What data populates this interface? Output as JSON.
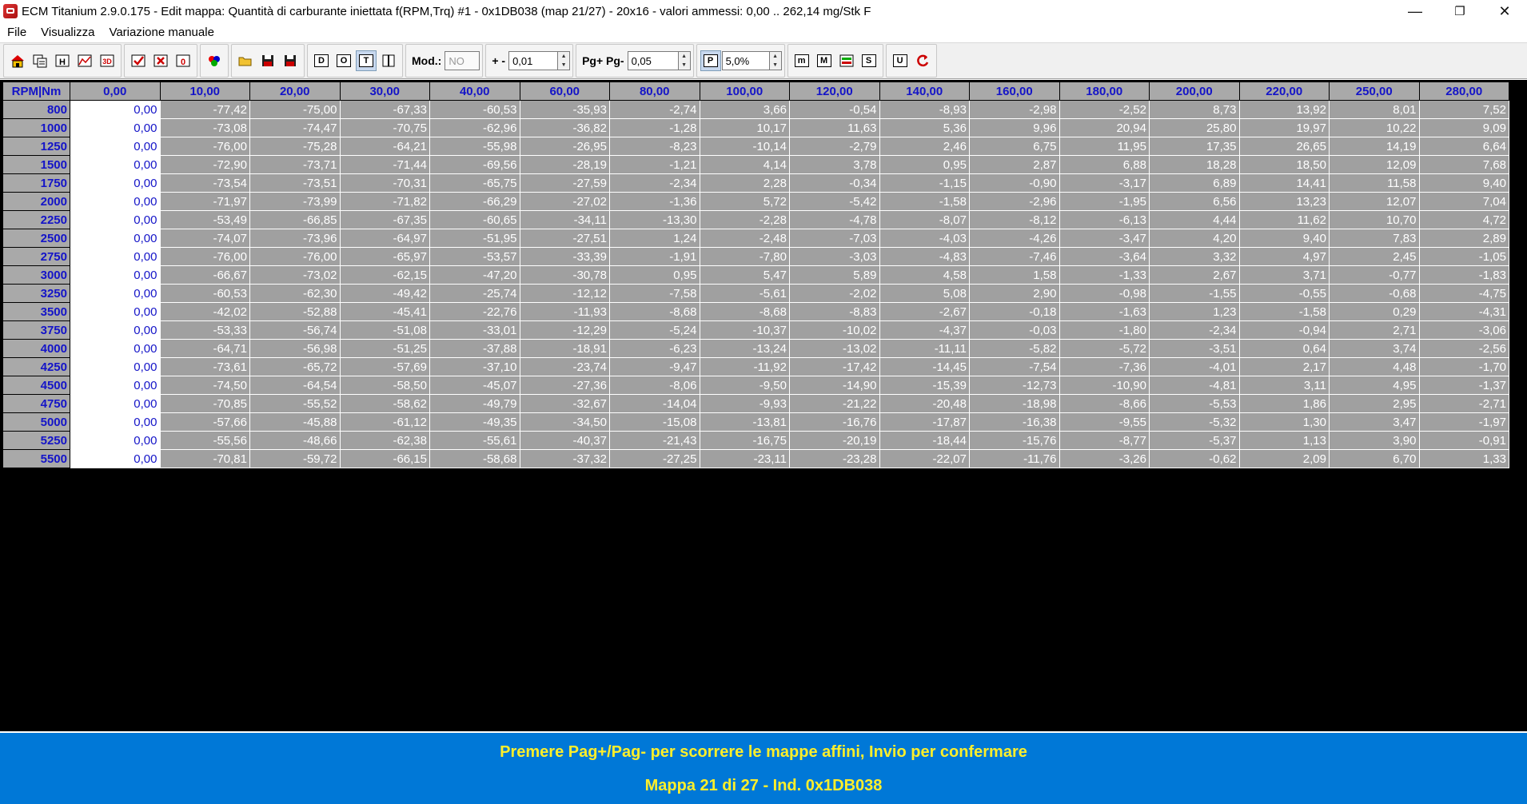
{
  "window": {
    "title": "ECM Titanium 2.9.0.175 - Edit mappa: Quantità di carburante iniettata f(RPM,Trq) #1 - 0x1DB038 (map 21/27) - 20x16 - valori ammessi: 0,00 .. 262,14 mg/Stk F",
    "minimize": "—",
    "restore": "❐",
    "close": "✕"
  },
  "menu": [
    "File",
    "Visualizza",
    "Variazione manuale"
  ],
  "toolbar": {
    "mod_label": "Mod.:",
    "mod_value": "NO",
    "plusminus_label": "+ -",
    "step_value": "0,01",
    "pg_label": "Pg+ Pg-",
    "pg_value": "0,05",
    "pct_value": "5,0%",
    "btn_d": "D",
    "btn_o": "O",
    "btn_t": "T",
    "btn_p": "P",
    "btn_m": "m",
    "btn_M": "M",
    "btn_s": "S",
    "btn_u": "U"
  },
  "table": {
    "corner": "RPM|Nm",
    "columns": [
      "0,00",
      "10,00",
      "20,00",
      "30,00",
      "40,00",
      "60,00",
      "80,00",
      "100,00",
      "120,00",
      "140,00",
      "160,00",
      "180,00",
      "200,00",
      "220,00",
      "250,00",
      "280,00"
    ],
    "rows": [
      {
        "rpm": "800",
        "values": [
          "0,00",
          "-77,42",
          "-75,00",
          "-67,33",
          "-60,53",
          "-35,93",
          "-2,74",
          "3,66",
          "-0,54",
          "-8,93",
          "-2,98",
          "-2,52",
          "8,73",
          "13,92",
          "8,01",
          "7,52"
        ]
      },
      {
        "rpm": "1000",
        "values": [
          "0,00",
          "-73,08",
          "-74,47",
          "-70,75",
          "-62,96",
          "-36,82",
          "-1,28",
          "10,17",
          "11,63",
          "5,36",
          "9,96",
          "20,94",
          "25,80",
          "19,97",
          "10,22",
          "9,09"
        ]
      },
      {
        "rpm": "1250",
        "values": [
          "0,00",
          "-76,00",
          "-75,28",
          "-64,21",
          "-55,98",
          "-26,95",
          "-8,23",
          "-10,14",
          "-2,79",
          "2,46",
          "6,75",
          "11,95",
          "17,35",
          "26,65",
          "14,19",
          "6,64"
        ]
      },
      {
        "rpm": "1500",
        "values": [
          "0,00",
          "-72,90",
          "-73,71",
          "-71,44",
          "-69,56",
          "-28,19",
          "-1,21",
          "4,14",
          "3,78",
          "0,95",
          "2,87",
          "6,88",
          "18,28",
          "18,50",
          "12,09",
          "7,68"
        ]
      },
      {
        "rpm": "1750",
        "values": [
          "0,00",
          "-73,54",
          "-73,51",
          "-70,31",
          "-65,75",
          "-27,59",
          "-2,34",
          "2,28",
          "-0,34",
          "-1,15",
          "-0,90",
          "-3,17",
          "6,89",
          "14,41",
          "11,58",
          "9,40"
        ]
      },
      {
        "rpm": "2000",
        "values": [
          "0,00",
          "-71,97",
          "-73,99",
          "-71,82",
          "-66,29",
          "-27,02",
          "-1,36",
          "5,72",
          "-5,42",
          "-1,58",
          "-2,96",
          "-1,95",
          "6,56",
          "13,23",
          "12,07",
          "7,04"
        ]
      },
      {
        "rpm": "2250",
        "values": [
          "0,00",
          "-53,49",
          "-66,85",
          "-67,35",
          "-60,65",
          "-34,11",
          "-13,30",
          "-2,28",
          "-4,78",
          "-8,07",
          "-8,12",
          "-6,13",
          "4,44",
          "11,62",
          "10,70",
          "4,72"
        ]
      },
      {
        "rpm": "2500",
        "values": [
          "0,00",
          "-74,07",
          "-73,96",
          "-64,97",
          "-51,95",
          "-27,51",
          "1,24",
          "-2,48",
          "-7,03",
          "-4,03",
          "-4,26",
          "-3,47",
          "4,20",
          "9,40",
          "7,83",
          "2,89"
        ]
      },
      {
        "rpm": "2750",
        "values": [
          "0,00",
          "-76,00",
          "-76,00",
          "-65,97",
          "-53,57",
          "-33,39",
          "-1,91",
          "-7,80",
          "-3,03",
          "-4,83",
          "-7,46",
          "-3,64",
          "3,32",
          "4,97",
          "2,45",
          "-1,05"
        ]
      },
      {
        "rpm": "3000",
        "values": [
          "0,00",
          "-66,67",
          "-73,02",
          "-62,15",
          "-47,20",
          "-30,78",
          "0,95",
          "5,47",
          "5,89",
          "4,58",
          "1,58",
          "-1,33",
          "2,67",
          "3,71",
          "-0,77",
          "-1,83"
        ]
      },
      {
        "rpm": "3250",
        "values": [
          "0,00",
          "-60,53",
          "-62,30",
          "-49,42",
          "-25,74",
          "-12,12",
          "-7,58",
          "-5,61",
          "-2,02",
          "5,08",
          "2,90",
          "-0,98",
          "-1,55",
          "-0,55",
          "-0,68",
          "-4,75"
        ]
      },
      {
        "rpm": "3500",
        "values": [
          "0,00",
          "-42,02",
          "-52,88",
          "-45,41",
          "-22,76",
          "-11,93",
          "-8,68",
          "-8,68",
          "-8,83",
          "-2,67",
          "-0,18",
          "-1,63",
          "1,23",
          "-1,58",
          "0,29",
          "-4,31"
        ]
      },
      {
        "rpm": "3750",
        "values": [
          "0,00",
          "-53,33",
          "-56,74",
          "-51,08",
          "-33,01",
          "-12,29",
          "-5,24",
          "-10,37",
          "-10,02",
          "-4,37",
          "-0,03",
          "-1,80",
          "-2,34",
          "-0,94",
          "2,71",
          "-3,06"
        ]
      },
      {
        "rpm": "4000",
        "values": [
          "0,00",
          "-64,71",
          "-56,98",
          "-51,25",
          "-37,88",
          "-18,91",
          "-6,23",
          "-13,24",
          "-13,02",
          "-11,11",
          "-5,82",
          "-5,72",
          "-3,51",
          "0,64",
          "3,74",
          "-2,56"
        ]
      },
      {
        "rpm": "4250",
        "values": [
          "0,00",
          "-73,61",
          "-65,72",
          "-57,69",
          "-37,10",
          "-23,74",
          "-9,47",
          "-11,92",
          "-17,42",
          "-14,45",
          "-7,54",
          "-7,36",
          "-4,01",
          "2,17",
          "4,48",
          "-1,70"
        ]
      },
      {
        "rpm": "4500",
        "values": [
          "0,00",
          "-74,50",
          "-64,54",
          "-58,50",
          "-45,07",
          "-27,36",
          "-8,06",
          "-9,50",
          "-14,90",
          "-15,39",
          "-12,73",
          "-10,90",
          "-4,81",
          "3,11",
          "4,95",
          "-1,37"
        ]
      },
      {
        "rpm": "4750",
        "values": [
          "0,00",
          "-70,85",
          "-55,52",
          "-58,62",
          "-49,79",
          "-32,67",
          "-14,04",
          "-9,93",
          "-21,22",
          "-20,48",
          "-18,98",
          "-8,66",
          "-5,53",
          "1,86",
          "2,95",
          "-2,71"
        ]
      },
      {
        "rpm": "5000",
        "values": [
          "0,00",
          "-57,66",
          "-45,88",
          "-61,12",
          "-49,35",
          "-34,50",
          "-15,08",
          "-13,81",
          "-16,76",
          "-17,87",
          "-16,38",
          "-9,55",
          "-5,32",
          "1,30",
          "3,47",
          "-1,97"
        ]
      },
      {
        "rpm": "5250",
        "values": [
          "0,00",
          "-55,56",
          "-48,66",
          "-62,38",
          "-55,61",
          "-40,37",
          "-21,43",
          "-16,75",
          "-20,19",
          "-18,44",
          "-15,76",
          "-8,77",
          "-5,37",
          "1,13",
          "3,90",
          "-0,91"
        ]
      },
      {
        "rpm": "5500",
        "values": [
          "0,00",
          "-70,81",
          "-59,72",
          "-66,15",
          "-58,68",
          "-37,32",
          "-27,25",
          "-23,11",
          "-23,28",
          "-22,07",
          "-11,76",
          "-3,26",
          "-0,62",
          "2,09",
          "6,70",
          "1,33"
        ]
      }
    ]
  },
  "status": {
    "line1": "Premere Pag+/Pag- per scorrere le mappe affini, Invio per confermare",
    "line2": "Mappa 21 di 27 - Ind. 0x1DB038"
  }
}
